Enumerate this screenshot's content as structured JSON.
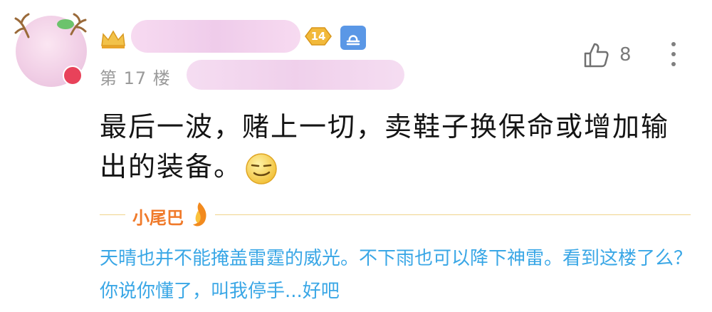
{
  "post": {
    "floor": "第 17 楼",
    "level": "14",
    "like_count": "8",
    "body": "最后一波，赌上一切，卖鞋子换保命或增加输出的装备。"
  },
  "tail": {
    "label": "小尾巴",
    "text": "天晴也并不能掩盖雷霆的威光。不下雨也可以降下神雷。看到这楼了么？你说你懂了，叫我停手...好吧"
  },
  "colors": {
    "tail_text": "#3aa7e6",
    "tail_label": "#f07a2a",
    "level_badge": "#f2b93a",
    "zodiac_badge": "#5a97e6"
  },
  "icons": {
    "crown": "crown-icon",
    "zodiac": "libra-icon",
    "like": "thumbs-up-icon",
    "more": "more-vertical-icon",
    "emoji": "smirk-emoji-icon",
    "tail": "flame-icon"
  }
}
